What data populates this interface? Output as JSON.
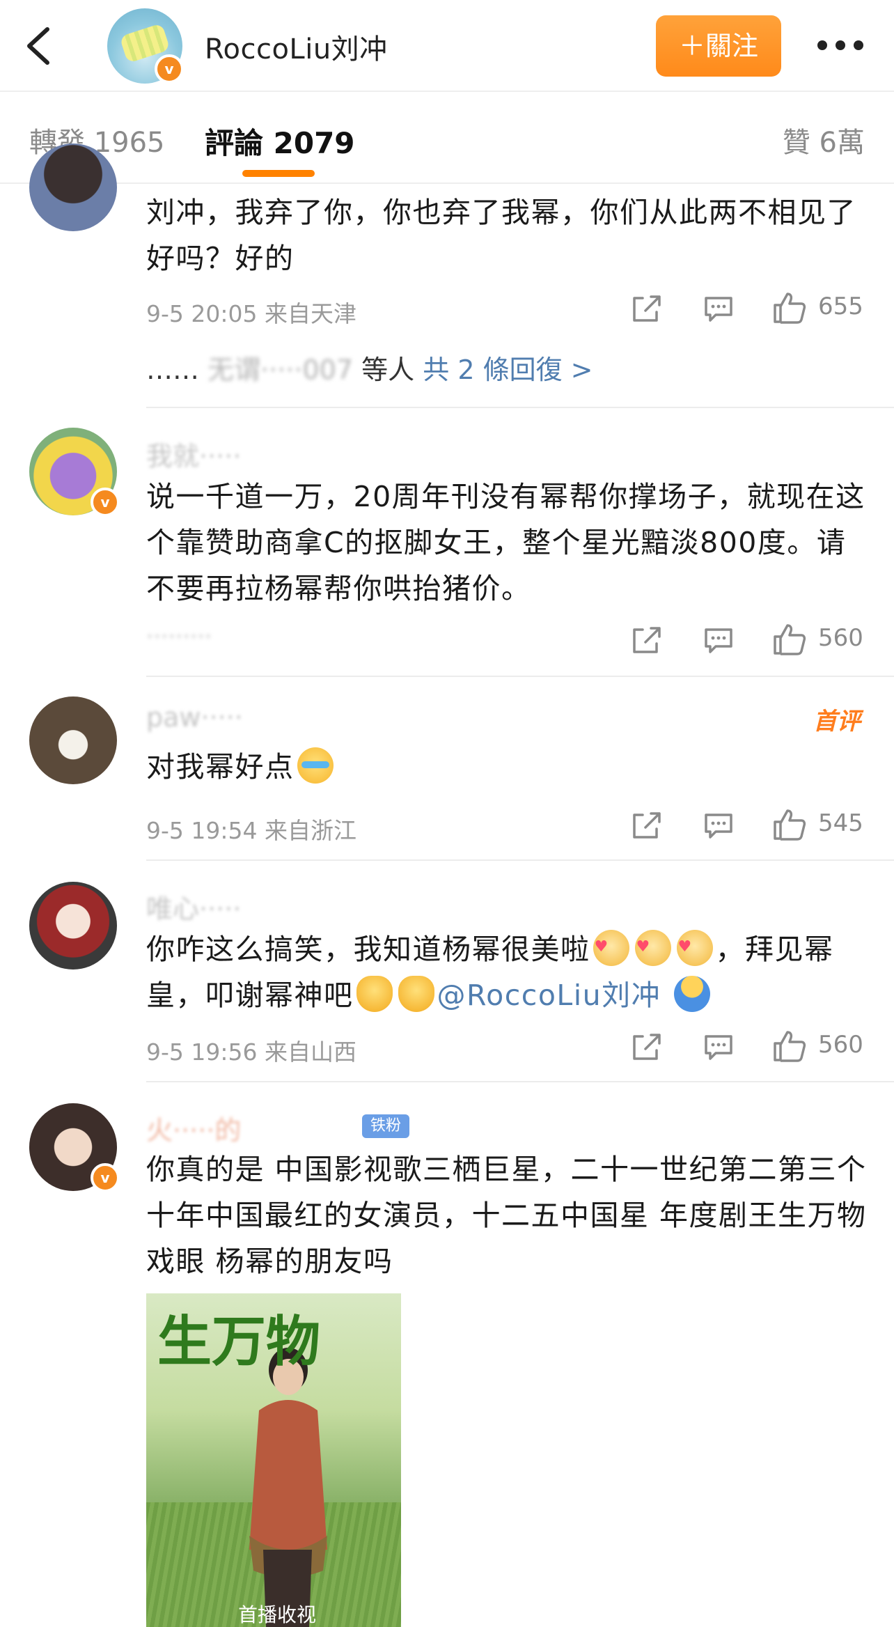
{
  "header": {
    "author_name": "RoccoLiu刘冲",
    "follow_label": "＋關注",
    "avatar_badge": "v"
  },
  "tabs": {
    "repost": "轉發 1965",
    "comments": "評論 2079",
    "likes": "贊 6萬"
  },
  "comments": [
    {
      "text": "刘冲，我弃了你，你也弃了我幂，你们从此两不相见了好吗？好的",
      "meta": "9-5 20:05  来自天津",
      "likes": "655",
      "reply_prefix": "……",
      "reply_users": "无谓·····007",
      "reply_suffix": "等人",
      "reply_link": "共 2 條回復 >"
    },
    {
      "username": "我就·····",
      "text": "说一千道一万，20周年刊没有幂帮你撑场子，就现在这个靠赞助商拿C的抠脚女王，整个星光黯淡800度。请不要再拉杨幂帮你哄抬猪价。",
      "meta": "·········",
      "likes": "560"
    },
    {
      "username": "paw·····",
      "badge": "首评",
      "text": "对我幂好点",
      "meta": "9-5 19:54  来自浙江",
      "likes": "545"
    },
    {
      "username": "唯心·····",
      "text_a": "你咋这么搞笑，我知道杨幂很美啦",
      "text_b": "，拜见幂皇，叩谢幂神吧",
      "mention": "@RoccoLiu刘冲",
      "meta": "9-5 19:56  来自山西",
      "likes": "560"
    },
    {
      "username": "火·····的",
      "fan_badge": "铁粉",
      "text": "你真的是 中国影视歌三栖巨星，二十一世纪第二第三个十年中国最红的女演员，十二五中国星 年度剧王生万物戏眼 杨幂的朋友吗",
      "poster_title": "生万物",
      "poster_caption": "首播收视"
    }
  ],
  "colors": {
    "accent": "#ff8200",
    "link": "#507daf",
    "verified": "#f58a1f"
  },
  "icons": [
    "back-icon",
    "more-icon",
    "share-icon",
    "reply-icon",
    "like-icon",
    "verified-icon"
  ]
}
